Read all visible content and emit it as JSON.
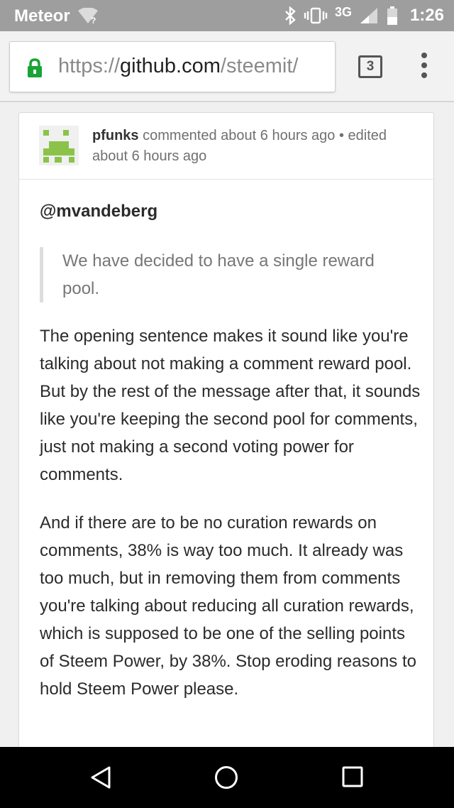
{
  "status_bar": {
    "carrier": "Meteor",
    "wifi_badge": "?",
    "network": "3G",
    "time": "1:26",
    "icons": [
      "wifi-icon",
      "bluetooth-icon",
      "vibrate-icon",
      "signal-icon",
      "battery-icon"
    ]
  },
  "browser": {
    "url_scheme": "https://",
    "url_host": "github.com",
    "url_path": "/steemit/",
    "tab_count": "3",
    "icons": [
      "lock-icon",
      "overflow-menu-icon"
    ],
    "accent_color": "#1aa336"
  },
  "comment": {
    "author": "pfunks",
    "meta_text": " commented about 6 hours ago • edited about 6 hours ago",
    "mention": "@mvandeberg",
    "quote": "We have decided to have a single reward pool.",
    "paragraphs": [
      "The opening sentence makes it sound like you're talking about not making a comment reward pool. But by the rest of the message after that, it sounds like you're keeping the second pool for comments, just not making a second voting power for comments.",
      "And if there are to be no curation rewards on comments, 38% is way too much. It already was too much, but in removing them from comments you're talking about reducing all curation rewards, which is supposed to be one of the selling points of Steem Power, by 38%. Stop eroding reasons to hold Steem Power please."
    ],
    "avatar_color": "#8bc34a"
  },
  "nav_bar": {
    "icons": [
      "back-icon",
      "home-icon",
      "recents-icon"
    ]
  }
}
